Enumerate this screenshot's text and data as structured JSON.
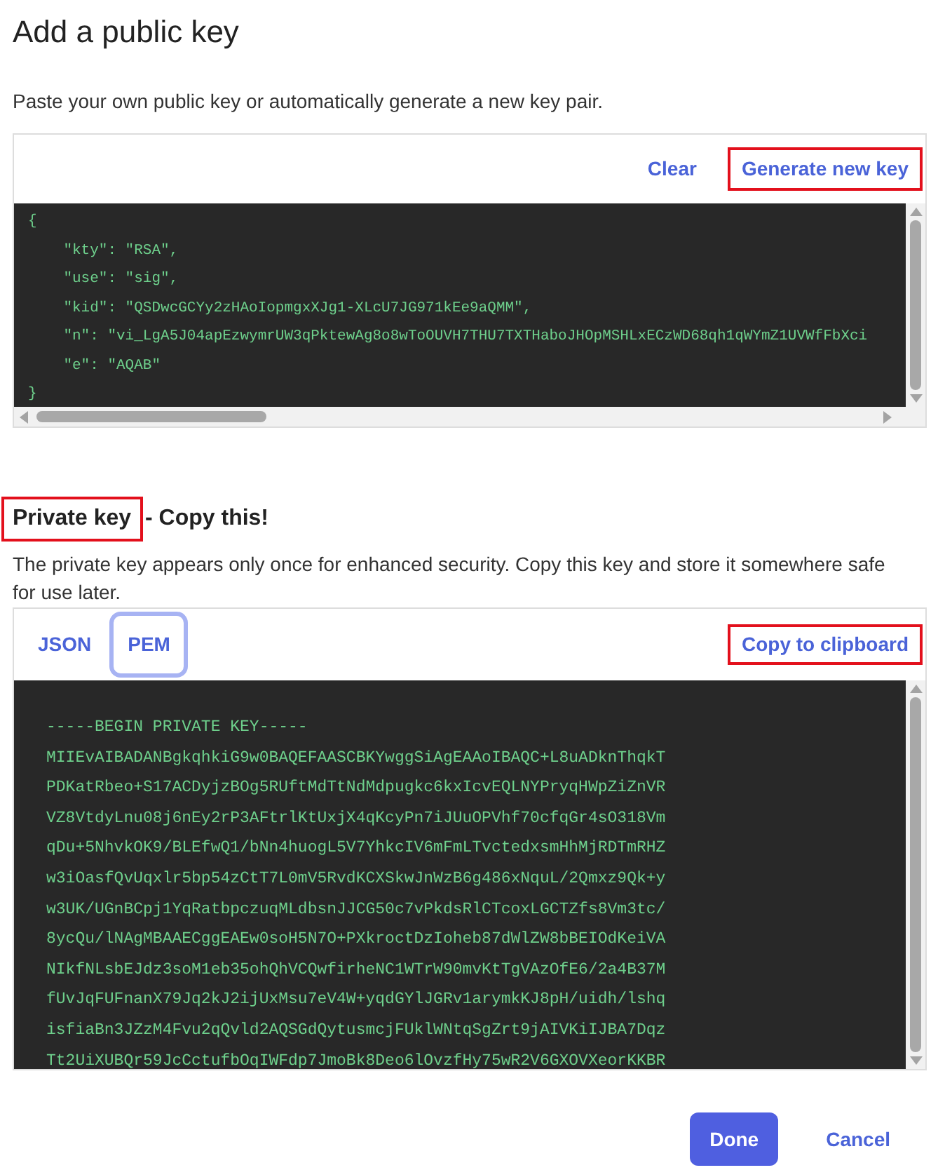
{
  "title": "Add a public key",
  "description": "Paste your own public key or automatically generate a new key pair.",
  "public_key": {
    "actions": [
      {
        "label": "Clear",
        "highlighted": false
      },
      {
        "label": "Generate new key",
        "highlighted": true
      }
    ],
    "lines": [
      "{",
      "    \"kty\": \"RSA\",",
      "    \"use\": \"sig\",",
      "    \"kid\": \"QSDwcGCYy2zHAoIopmgxXJg1-XLcU7JG971kEe9aQMM\",",
      "    \"n\": \"vi_LgA5J04apEzwymrUW3qPktewAg8o8wToOUVH7THU7TXTHaboJHOpMSHLxECzWD68qh1qWYmZ1UVWfFbXci",
      "    \"e\": \"AQAB\"",
      "}"
    ]
  },
  "private_key": {
    "heading": {
      "label": "Private key",
      "highlighted": true
    },
    "heading_rest": "- Copy this!",
    "description": "The private key appears only once for enhanced security. Copy this key and store it somewhere safe for use later.",
    "tabs": [
      {
        "label": "JSON",
        "selected": false
      },
      {
        "label": "PEM",
        "selected": true
      }
    ],
    "copy": {
      "label": "Copy to clipboard",
      "highlighted": true
    },
    "lines": [
      "-----BEGIN PRIVATE KEY-----",
      "MIIEvAIBADANBgkqhkiG9w0BAQEFAASCBKYwggSiAgEAAoIBAQC+L8uADknThqkT",
      "PDKatRbeo+S17ACDyjzBOg5RUftMdTtNdMdpugkc6kxIcvEQLNYPryqHWpZiZnVR",
      "VZ8VtdyLnu08j6nEy2rP3AFtrlKtUxjX4qKcyPn7iJUuOPVhf70cfqGr4sO318Vm",
      "qDu+5NhvkOK9/BLEfwQ1/bNn4huogL5V7YhkcIV6mFmLTvctedxsmHhMjRDTmRHZ",
      "w3iOasfQvUqxlr5bp54zCtT7L0mV5RvdKCXSkwJnWzB6g486xNquL/2Qmxz9Qk+y",
      "w3UK/UGnBCpj1YqRatbpczuqMLdbsnJJCG50c7vPkdsRlCTcoxLGCTZfs8Vm3tc/",
      "8ycQu/lNAgMBAAECggEAEw0soH5N7O+PXkroctDzIoheb87dWlZW8bBEIOdKeiVA",
      "NIkfNLsbEJdz3soM1eb35ohQhVCQwfirheNC1WTrW90mvKtTgVAzOfE6/2a4B37M",
      "fUvJqFUFnanX79Jq2kJ2ijUxMsu7eV4W+yqdGYlJGRv1arymkKJ8pH/uidh/lshq",
      "isfiaBn3JZzM4Fvu2qQvld2AQSGdQytusmcjFUklWNtqSgZrt9jAIVKiIJBA7Dqz",
      "Tt2UiXUBQr59JcCctufbOqIWFdp7JmoBk8Deo6lOvzfHy75wR2V6GXOVXeorKKBR"
    ]
  },
  "buttons": [
    {
      "label": "Done",
      "kind": "primary"
    },
    {
      "label": "Cancel",
      "kind": "secondary"
    }
  ]
}
